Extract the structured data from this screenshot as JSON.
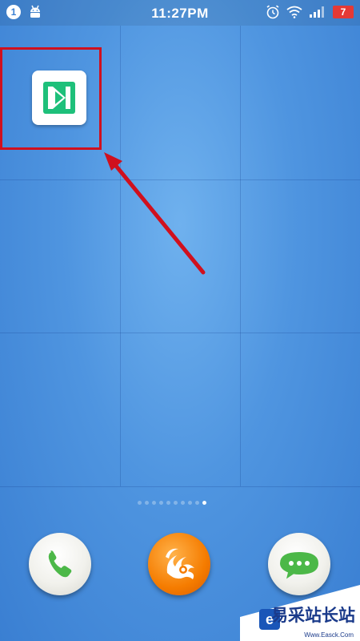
{
  "status_bar": {
    "notification_count": "1",
    "time": "11:27PM",
    "battery_level": "7",
    "battery_color": "#e53935"
  },
  "home_screen": {
    "highlight_color": "#d0101e",
    "app_icon_color": "#1ec07a",
    "page_count": 10,
    "active_page": 10
  },
  "dock": {
    "icons": [
      "phone-icon",
      "uc-browser-icon",
      "message-icon"
    ]
  },
  "watermark": {
    "brand": "易采站长站",
    "url": "Www.Easck.Com"
  }
}
